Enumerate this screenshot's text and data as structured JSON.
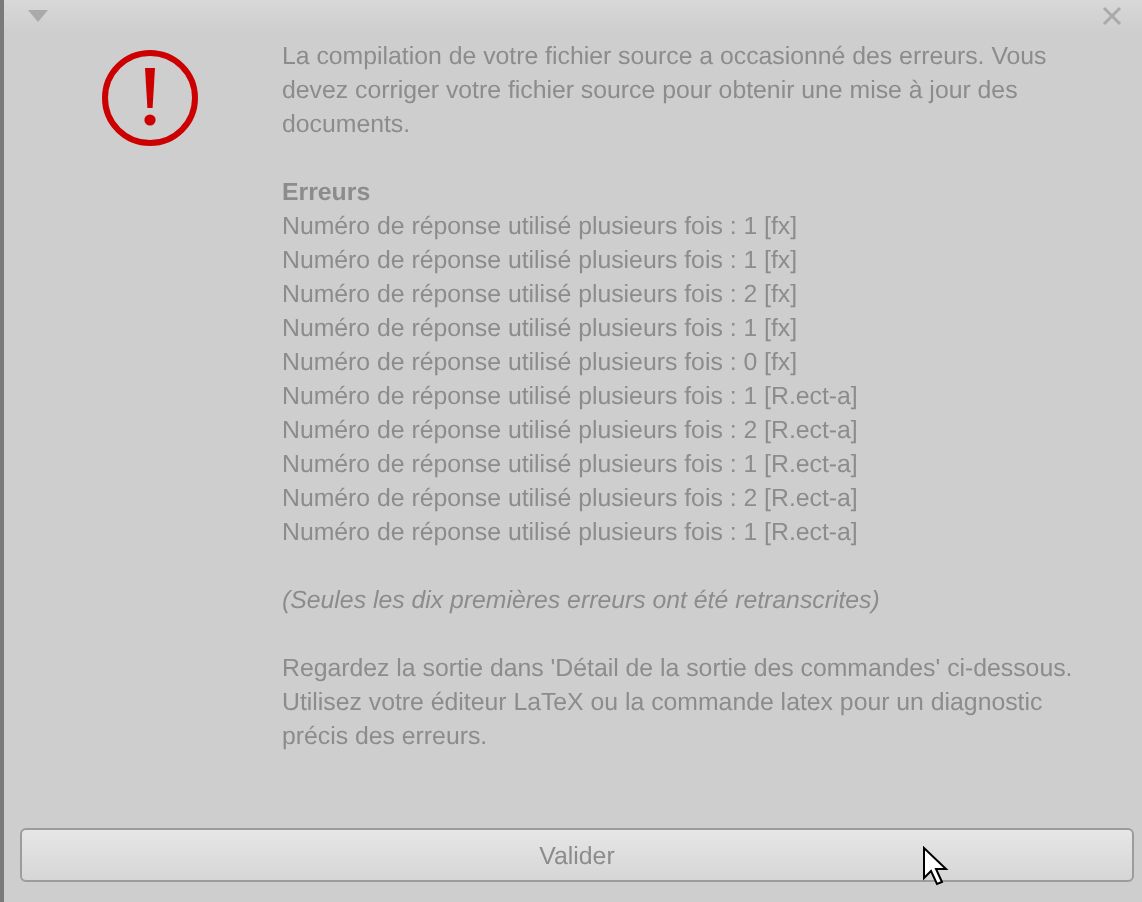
{
  "message": "La compilation de votre fichier source a occasionné des erreurs. Vous devez corriger votre fichier source pour obtenir une mise à jour des documents.",
  "errors_heading": "Erreurs",
  "errors": [
    "Numéro de réponse utilisé plusieurs fois : 1 [fx]",
    "Numéro de réponse utilisé plusieurs fois : 1 [fx]",
    "Numéro de réponse utilisé plusieurs fois : 2 [fx]",
    "Numéro de réponse utilisé plusieurs fois : 1 [fx]",
    "Numéro de réponse utilisé plusieurs fois : 0 [fx]",
    "Numéro de réponse utilisé plusieurs fois : 1 [R.ect-a]",
    "Numéro de réponse utilisé plusieurs fois : 2 [R.ect-a]",
    "Numéro de réponse utilisé plusieurs fois : 1 [R.ect-a]",
    "Numéro de réponse utilisé plusieurs fois : 2 [R.ect-a]",
    "Numéro de réponse utilisé plusieurs fois : 1 [R.ect-a]"
  ],
  "note": "(Seules les dix premières erreurs ont été retranscrites)",
  "advice": "Regardez la sortie dans 'Détail de la sortie des commandes' ci-dessous. Utilisez votre éditeur LaTeX ou la commande latex pour un diagnostic précis des erreurs.",
  "button": "Valider"
}
